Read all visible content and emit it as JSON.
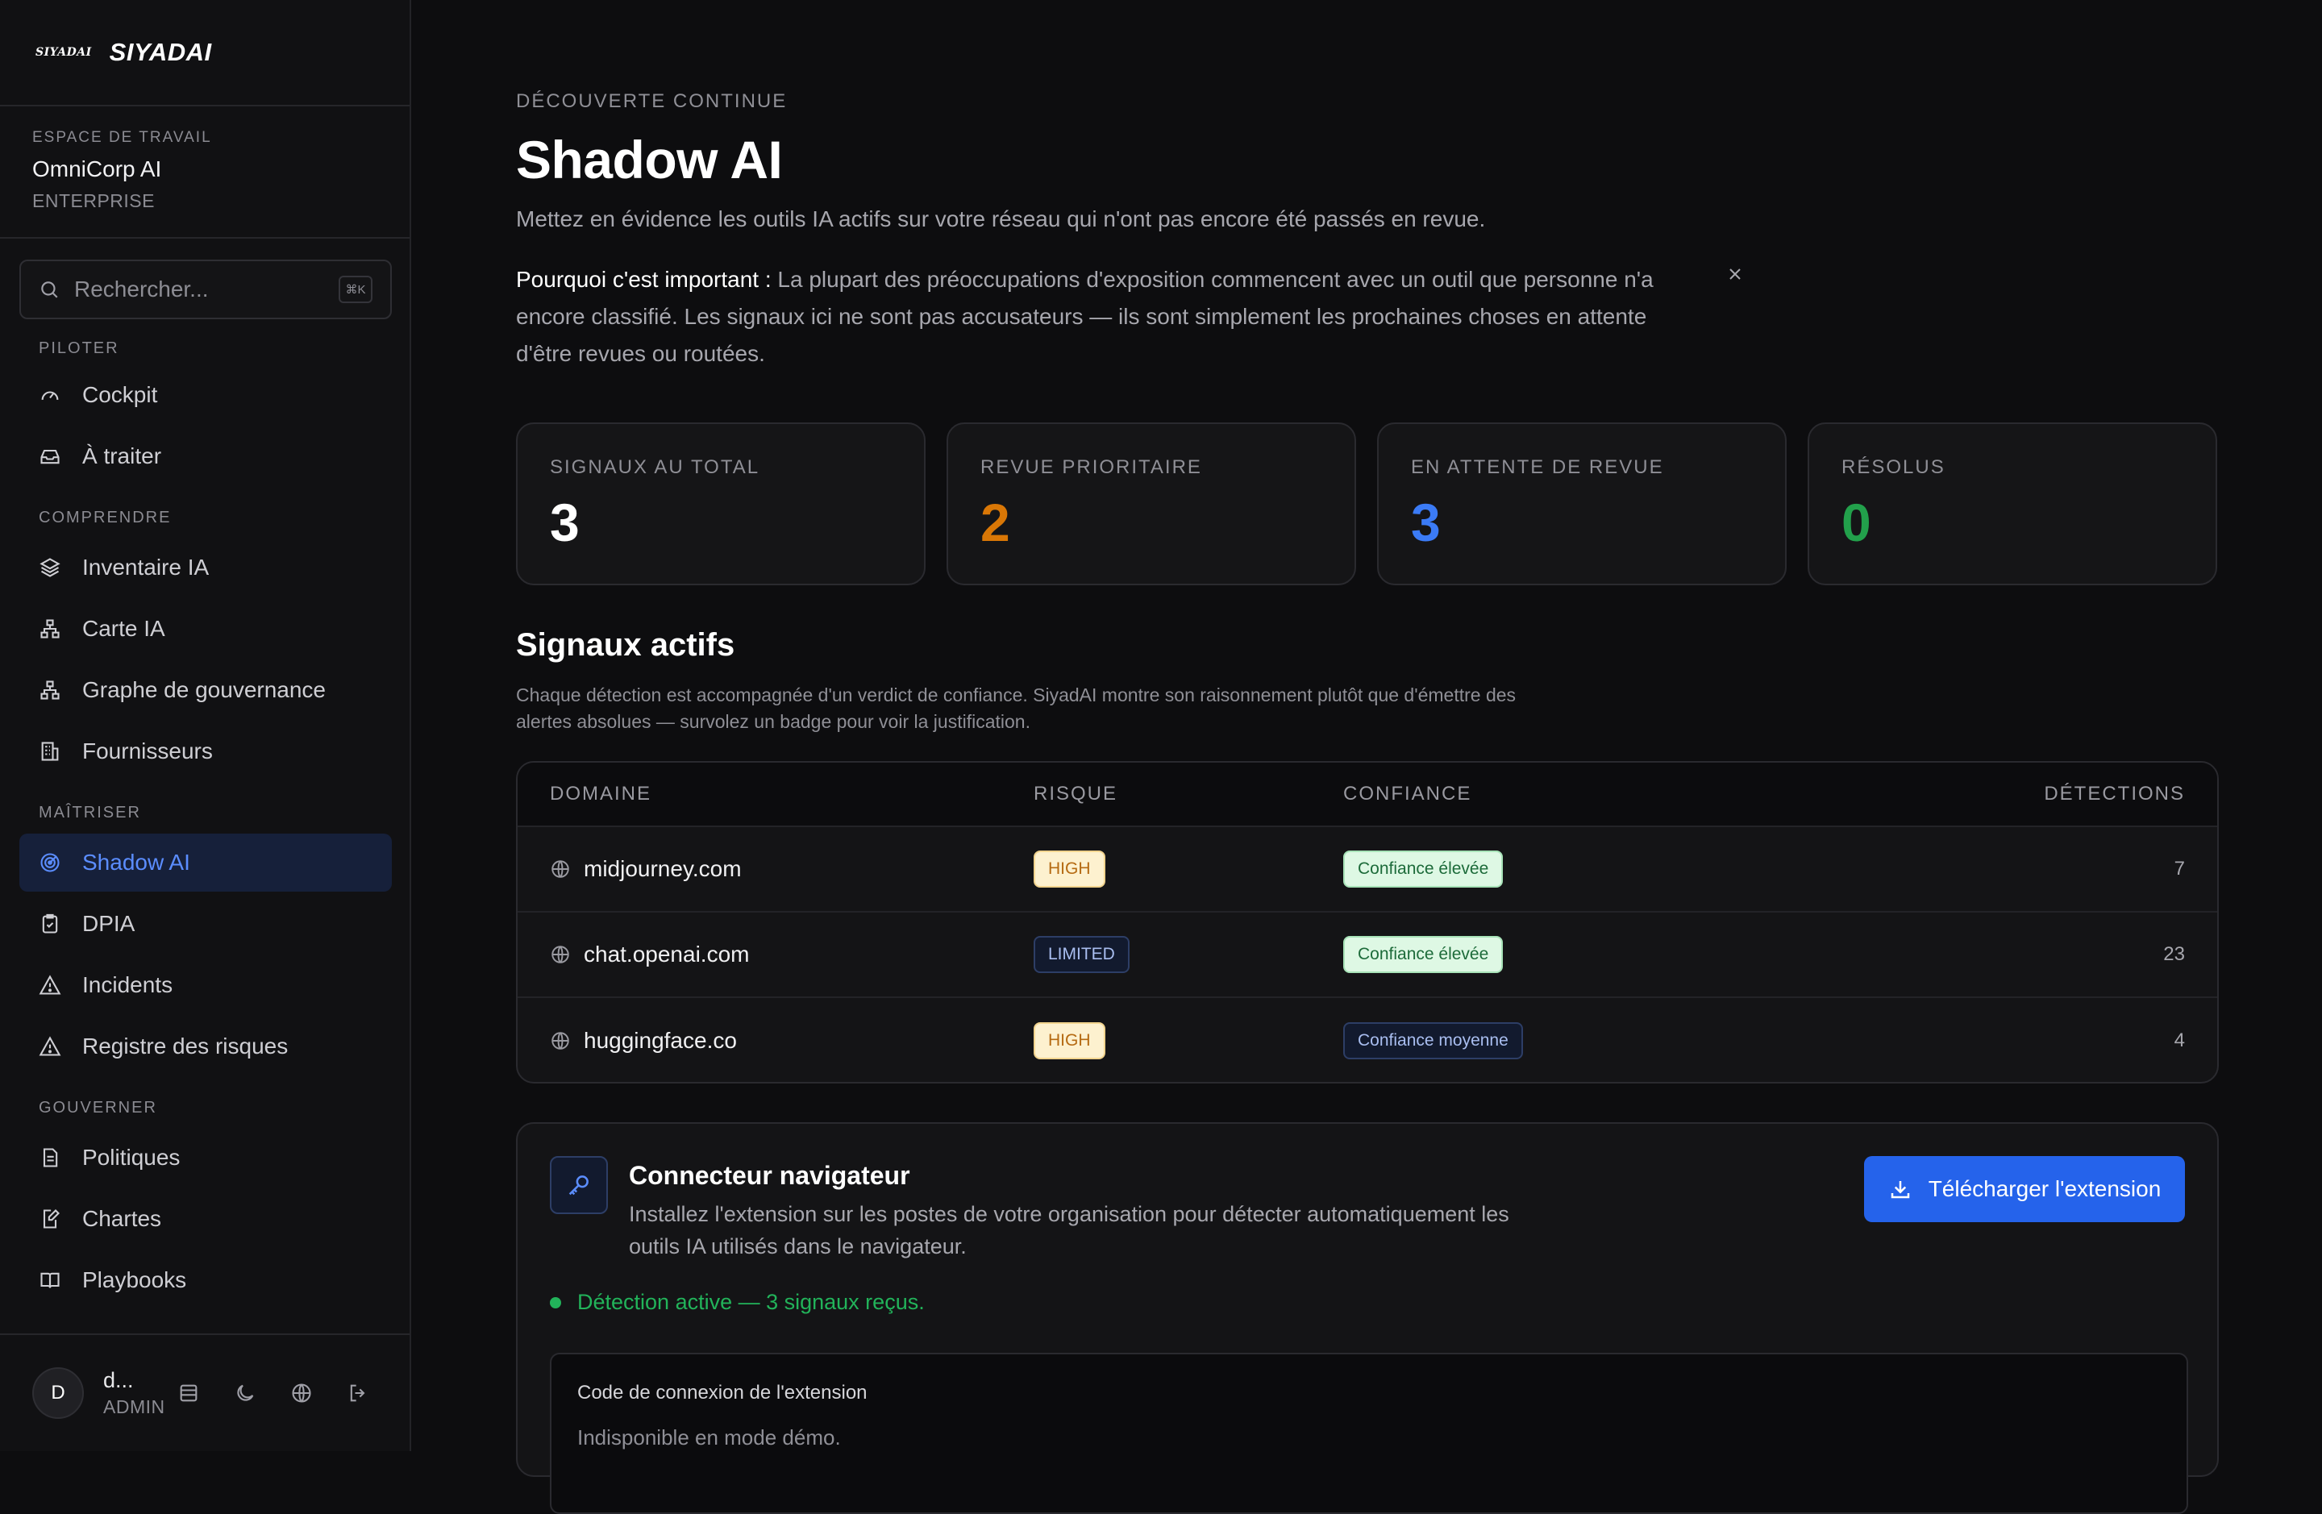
{
  "brand": {
    "mark": "SIYADAI",
    "name": "SIYADAI"
  },
  "workspace": {
    "label": "ESPACE DE TRAVAIL",
    "name": "OmniCorp AI",
    "plan": "ENTERPRISE"
  },
  "search": {
    "placeholder": "Rechercher...",
    "shortcut": "⌘K"
  },
  "nav": {
    "sections": [
      {
        "title": "PILOTER",
        "items": [
          {
            "label": "Cockpit",
            "icon": "gauge-icon"
          },
          {
            "label": "À traiter",
            "icon": "inbox-icon"
          }
        ]
      },
      {
        "title": "COMPRENDRE",
        "items": [
          {
            "label": "Inventaire IA",
            "icon": "layers-icon"
          },
          {
            "label": "Carte IA",
            "icon": "network-icon"
          },
          {
            "label": "Graphe de gouvernance",
            "icon": "network-icon"
          },
          {
            "label": "Fournisseurs",
            "icon": "building-icon"
          }
        ]
      },
      {
        "title": "MAÎTRISER",
        "items": [
          {
            "label": "Shadow AI",
            "icon": "radar-icon",
            "active": true
          },
          {
            "label": "DPIA",
            "icon": "clipboard-icon"
          },
          {
            "label": "Incidents",
            "icon": "warning-icon"
          },
          {
            "label": "Registre des risques",
            "icon": "warning-icon"
          }
        ]
      },
      {
        "title": "GOUVERNER",
        "items": [
          {
            "label": "Politiques",
            "icon": "document-icon"
          },
          {
            "label": "Chartes",
            "icon": "edit-document-icon"
          },
          {
            "label": "Playbooks",
            "icon": "book-icon"
          }
        ]
      }
    ]
  },
  "user": {
    "initial": "D",
    "name": "d...",
    "role": "ADMIN"
  },
  "page": {
    "eyebrow": "DÉCOUVERTE CONTINUE",
    "title": "Shadow AI",
    "subtitle": "Mettez en évidence les outils IA actifs sur votre réseau qui n'ont pas encore été passés en revue.",
    "why_label": "Pourquoi c'est important :",
    "why_text": " La plupart des préoccupations d'exposition commencent avec un outil que personne n'a encore classifié. Les signaux ici ne sont pas accusateurs — ils sont simplement les prochaines choses en attente d'être revues ou routées."
  },
  "stats": [
    {
      "label": "SIGNAUX AU TOTAL",
      "value": "3",
      "color": "#ffffff"
    },
    {
      "label": "REVUE PRIORITAIRE",
      "value": "2",
      "color": "#d97706"
    },
    {
      "label": "EN ATTENTE DE REVUE",
      "value": "3",
      "color": "#3b7bf6"
    },
    {
      "label": "RÉSOLUS",
      "value": "0",
      "color": "#22a04b"
    }
  ],
  "signals": {
    "title": "Signaux actifs",
    "description": "Chaque détection est accompagnée d'un verdict de confiance. SiyadAI montre son raisonnement plutôt que d'émettre des alertes absolues — survolez un badge pour voir la justification.",
    "columns": {
      "domain": "DOMAINE",
      "risk": "RISQUE",
      "confidence": "CONFIANCE",
      "detections": "DÉTECTIONS"
    },
    "rows": [
      {
        "domain": "midjourney.com",
        "risk": "HIGH",
        "confidence": "Confiance élevée",
        "detections": "7"
      },
      {
        "domain": "chat.openai.com",
        "risk": "LIMITED",
        "confidence": "Confiance élevée",
        "detections": "23"
      },
      {
        "domain": "huggingface.co",
        "risk": "HIGH",
        "confidence": "Confiance moyenne",
        "detections": "4"
      }
    ]
  },
  "connector": {
    "title": "Connecteur navigateur",
    "description": "Installez l'extension sur les postes de votre organisation pour détecter automatiquement les outils IA utilisés dans le navigateur.",
    "button": "Télécharger l'extension",
    "status": "Détection active — 3 signaux reçus.",
    "code_label": "Code de connexion de l'extension",
    "code_value": "Indisponible en mode démo."
  },
  "colors": {
    "accent": "#2563eb",
    "active_nav": "#5b8dff",
    "success": "#22b35a"
  }
}
